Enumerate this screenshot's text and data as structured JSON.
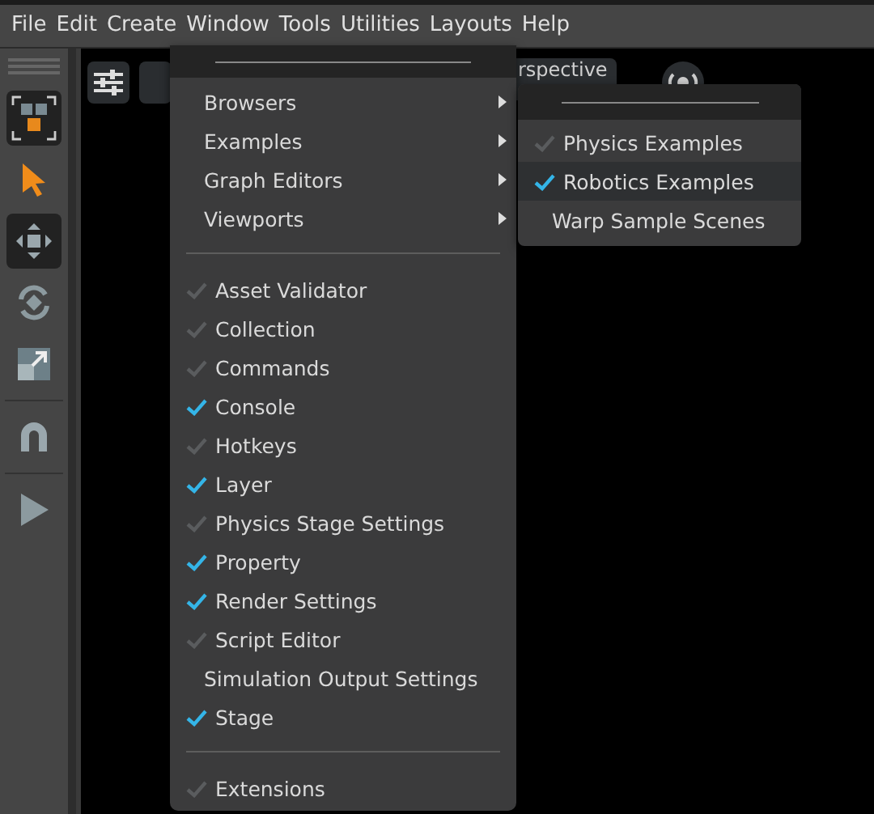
{
  "menubar": [
    {
      "label": "File"
    },
    {
      "label": "Edit"
    },
    {
      "label": "Create"
    },
    {
      "label": "Window"
    },
    {
      "label": "Tools"
    },
    {
      "label": "Utilities"
    },
    {
      "label": "Layouts"
    },
    {
      "label": "Help"
    }
  ],
  "viewport": {
    "camera_label": "rspective"
  },
  "window_menu": {
    "submenus": [
      {
        "label": "Browsers"
      },
      {
        "label": "Examples"
      },
      {
        "label": "Graph Editors"
      },
      {
        "label": "Viewports"
      }
    ],
    "windows": [
      {
        "label": "Asset Validator",
        "kind": "check",
        "checked": false
      },
      {
        "label": "Collection",
        "kind": "check",
        "checked": false
      },
      {
        "label": "Commands",
        "kind": "check",
        "checked": false
      },
      {
        "label": "Console",
        "kind": "check",
        "checked": true
      },
      {
        "label": "Hotkeys",
        "kind": "check",
        "checked": false
      },
      {
        "label": "Layer",
        "kind": "check",
        "checked": true
      },
      {
        "label": "Physics Stage Settings",
        "kind": "check",
        "checked": false
      },
      {
        "label": "Property",
        "kind": "check",
        "checked": true
      },
      {
        "label": "Render Settings",
        "kind": "check",
        "checked": true
      },
      {
        "label": "Script Editor",
        "kind": "check",
        "checked": false
      },
      {
        "label": "Simulation Output Settings",
        "kind": "plain"
      },
      {
        "label": "Stage",
        "kind": "check",
        "checked": true
      }
    ],
    "extensions": [
      {
        "label": "Extensions",
        "kind": "check",
        "checked": false
      }
    ]
  },
  "examples_submenu": [
    {
      "label": "Physics Examples",
      "kind": "check",
      "checked": false,
      "selected": false
    },
    {
      "label": "Robotics Examples",
      "kind": "check",
      "checked": true,
      "selected": true
    },
    {
      "label": "Warp Sample Scenes",
      "kind": "plain",
      "selected": false
    }
  ]
}
